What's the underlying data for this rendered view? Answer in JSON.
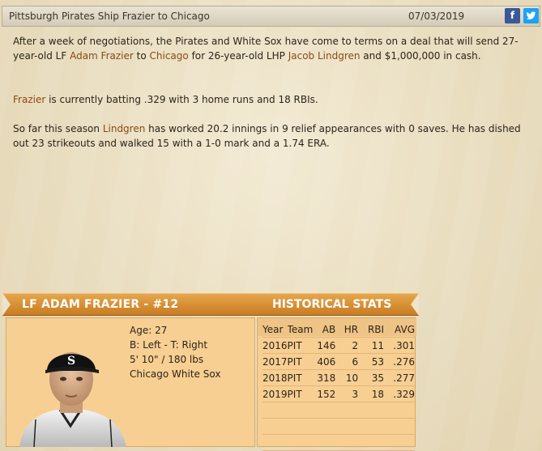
{
  "header": {
    "title": "Pittsburgh Pirates Ship Frazier to Chicago",
    "date": "07/03/2019",
    "facebook_icon": "f",
    "twitter_icon": "t"
  },
  "article": {
    "p1": {
      "t1": "After a week of negotiations, the Pirates and White Sox have come to terms on a deal that will send 27-year-old LF ",
      "l1": "Adam Frazier",
      "t2": " to ",
      "l2": "Chicago",
      "t3": " for 26-year-old LHP ",
      "l3": "Jacob Lindgren",
      "t4": " and $1,000,000 in cash."
    },
    "p2": {
      "l1": "Frazier",
      "t1": " is currently batting .329 with 3 home runs and 18 RBIs."
    },
    "p3": {
      "t1": "So far this season ",
      "l1": "Lindgren",
      "t2": " has worked 20.2 innings in 9 relief appearances with 0 saves. He has dished out 23 strikeouts and walked 15 with a 1-0 mark and a 1.74 ERA."
    }
  },
  "card": {
    "player_header": "LF ADAM FRAZIER - #12",
    "stats_header": "HISTORICAL STATS",
    "info": {
      "age": "Age: 27",
      "bats_throws": "B: Left - T: Right",
      "height_weight": "5' 10\" / 180 lbs",
      "team": "Chicago White Sox"
    },
    "stats": {
      "columns": [
        "Year",
        "Team",
        "AB",
        "HR",
        "RBI",
        "AVG"
      ],
      "rows": [
        [
          "2016",
          "PIT",
          "146",
          "2",
          "11",
          ".301"
        ],
        [
          "2017",
          "PIT",
          "406",
          "6",
          "53",
          ".276"
        ],
        [
          "2018",
          "PIT",
          "318",
          "10",
          "35",
          ".277"
        ],
        [
          "2019",
          "PIT",
          "152",
          "3",
          "18",
          ".329"
        ]
      ]
    }
  },
  "colors": {
    "link": "#8a4a12",
    "card_orange": "#d98d30",
    "panel": "#f8cf93"
  }
}
